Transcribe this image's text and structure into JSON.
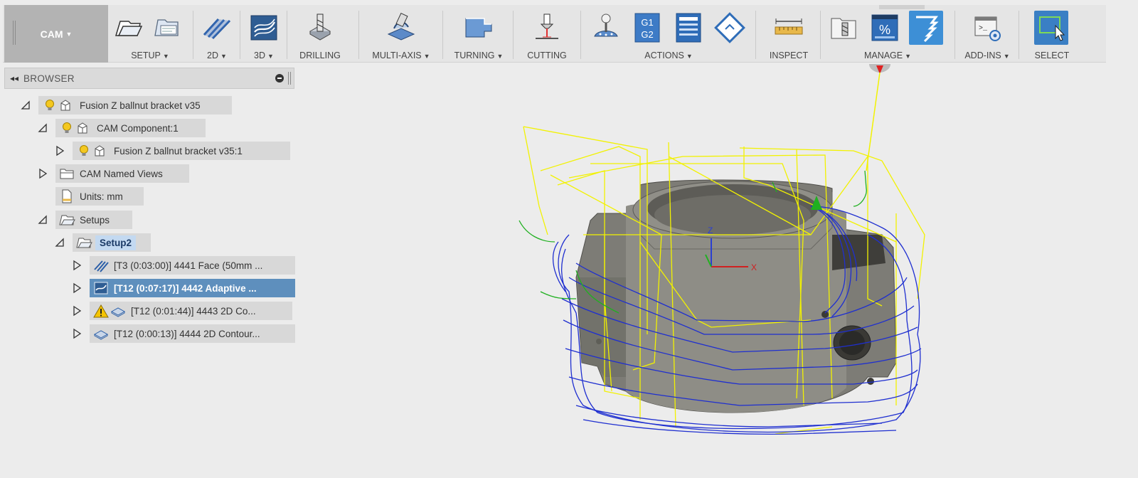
{
  "toolbar": {
    "workspace": "CAM",
    "groups": {
      "setup": "SETUP",
      "two_d": "2D",
      "three_d": "3D",
      "drilling": "DRILLING",
      "multi_axis": "MULTI-AXIS",
      "turning": "TURNING",
      "cutting": "CUTTING",
      "actions": "ACTIONS",
      "inspect": "INSPECT",
      "manage": "MANAGE",
      "add_ins": "ADD-INS",
      "select": "SELECT"
    },
    "g_code_icon": [
      "G1",
      "G2"
    ],
    "percent_icon": "%"
  },
  "browser": {
    "title": "BROWSER",
    "items": {
      "root": "Fusion Z ballnut bracket v35",
      "component": "CAM Component:1",
      "body": "Fusion Z ballnut bracket v35:1",
      "named_views": "CAM Named Views",
      "units": "Units: mm",
      "setups": "Setups",
      "setup2": "Setup2",
      "op1": "[T3 (0:03:00)] 4441 Face (50mm ...",
      "op2": "[T12 (0:07:17)] 4442 Adaptive ...",
      "op3": "[T12 (0:01:44)] 4443 2D Co...",
      "op4": "[T12 (0:00:13)] 4444 2D Contour..."
    }
  },
  "viewport": {
    "axis_z": "Z",
    "axis_x": "X",
    "colors": {
      "rapid": "#f2f200",
      "cut": "#1f2fd0",
      "lead": "#20b020",
      "part": "#7d7c76"
    }
  }
}
